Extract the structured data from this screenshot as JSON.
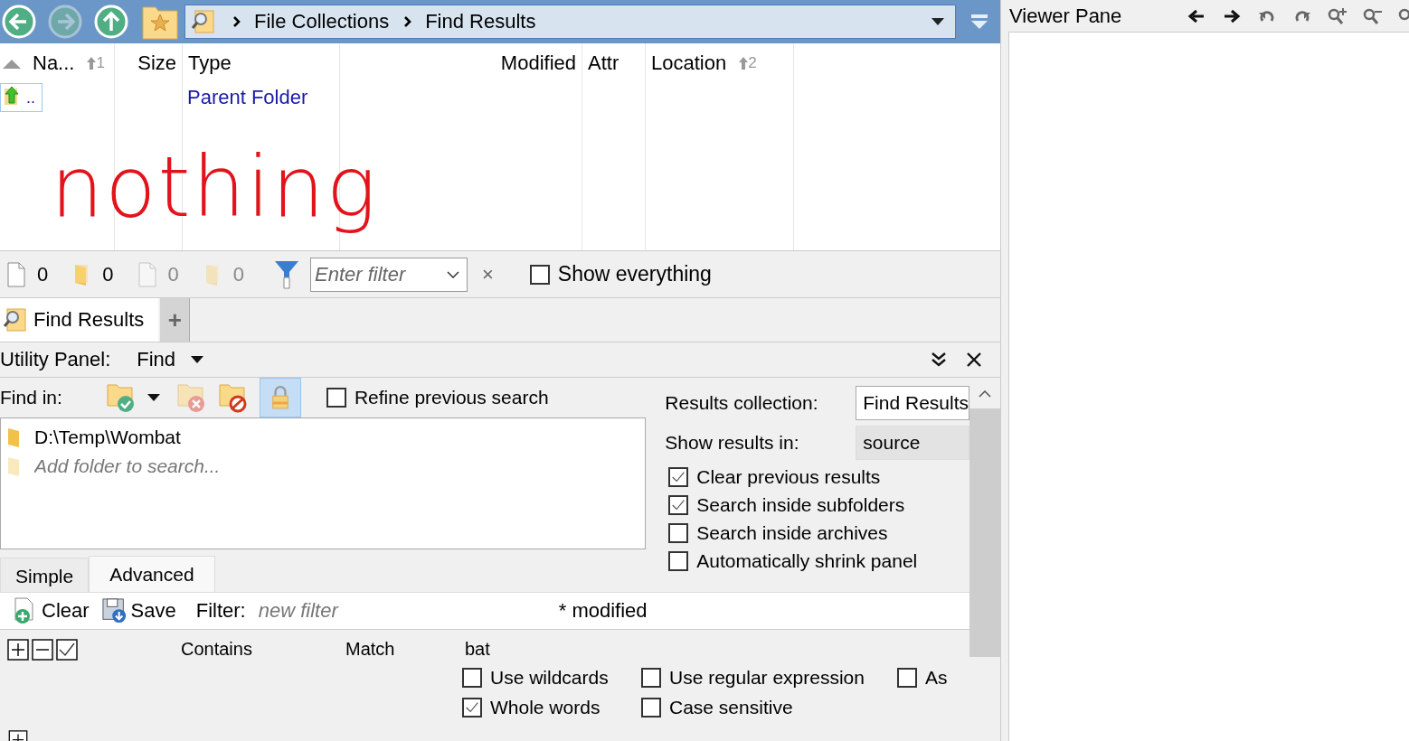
{
  "toolbar": {
    "breadcrumb": [
      "File Collections",
      "Find Results"
    ]
  },
  "file_list": {
    "columns": [
      {
        "label": "Na...",
        "sort": "1",
        "kind": "text"
      },
      {
        "label": "Size",
        "kind": "number"
      },
      {
        "label": "Type",
        "kind": "text"
      },
      {
        "label": "Modified",
        "kind": "number"
      },
      {
        "label": "Attr",
        "kind": "text"
      },
      {
        "label": "Location",
        "sort": "2",
        "kind": "text"
      }
    ],
    "rows": [
      {
        "name": "..",
        "type": "Parent Folder",
        "focused": true
      }
    ]
  },
  "annotation": {
    "text": "nothing",
    "color": "#e3131b"
  },
  "status_bar": {
    "counts": [
      {
        "kind": "file",
        "value": "0",
        "dimmed": false
      },
      {
        "kind": "folder",
        "value": "0",
        "dimmed": false
      },
      {
        "kind": "file",
        "value": "0",
        "dimmed": true
      },
      {
        "kind": "folder",
        "value": "0",
        "dimmed": true
      }
    ],
    "filter": {
      "placeholder": "Enter filter"
    },
    "clear": "×",
    "show_everything": {
      "label": "Show everything",
      "checked": false
    }
  },
  "tabs": [
    {
      "label": "Find Results",
      "selected": true
    }
  ],
  "add_tab": "+",
  "utility_panel": {
    "label": "Utility Panel:",
    "mode": "Find"
  },
  "find": {
    "find_in_label": "Find in:",
    "lock_active": true,
    "refine": {
      "label": "Refine previous search",
      "checked": false
    },
    "folders": [
      {
        "path": "D:\\Temp\\Wombat"
      }
    ],
    "add_placeholder": "Add folder to search...",
    "results_collection": {
      "label": "Results collection:",
      "value": "Find Results"
    },
    "show_results_in": {
      "label": "Show results in:",
      "value": "source"
    },
    "options": [
      {
        "label": "Clear previous results",
        "checked": true
      },
      {
        "label": "Search inside subfolders",
        "checked": true
      },
      {
        "label": "Search inside archives",
        "checked": false
      },
      {
        "label": "Automatically shrink panel",
        "checked": false
      }
    ],
    "mode_tabs": [
      {
        "label": "Simple",
        "selected": false
      },
      {
        "label": "Advanced",
        "selected": true
      }
    ],
    "filter_bar": {
      "clear": "Clear",
      "save": "Save",
      "filter_label": "Filter:",
      "filter_placeholder": "new filter",
      "modified": "* modified"
    },
    "clause": {
      "field": "Contains",
      "operator": "Match",
      "value": "bat",
      "options": [
        {
          "label": "Use wildcards",
          "checked": false
        },
        {
          "label": "Use regular expression",
          "checked": false
        },
        {
          "label": "As",
          "checked": false
        },
        {
          "label": "Whole words",
          "checked": true
        },
        {
          "label": "Case sensitive",
          "checked": false
        }
      ]
    }
  },
  "viewer": {
    "title": "Viewer Pane"
  }
}
